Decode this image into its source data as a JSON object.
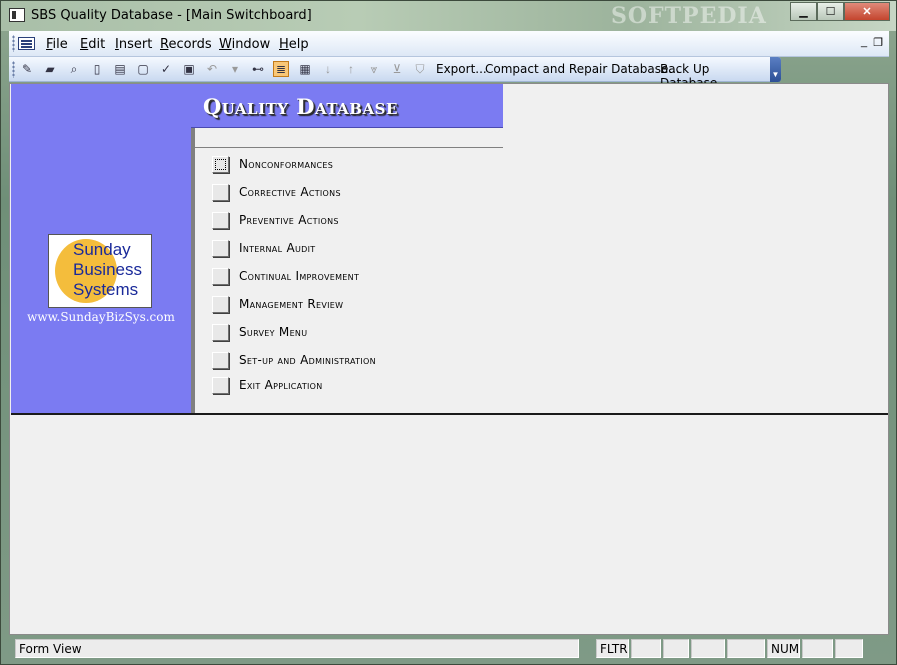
{
  "window": {
    "title": "SBS Quality Database - [Main Switchboard]",
    "watermark": "SOFTPEDIA",
    "controls": {
      "minimize": "▁",
      "maximize": "☐",
      "close": "✕"
    }
  },
  "menubar": {
    "items": [
      "File",
      "Edit",
      "Insert",
      "Records",
      "Window",
      "Help"
    ],
    "mdi_minimize": "_",
    "mdi_restore": "❐"
  },
  "toolbar": {
    "icons": [
      "design-view-icon",
      "open-icon",
      "search-icon",
      "print-preview-book-icon",
      "print-icon",
      "print-preview-icon",
      "spelling-icon",
      "paste-icon",
      "undo-icon",
      "find-icon",
      "form-view-icon",
      "datasheet-icon",
      "sort-icon",
      "filter-selection-icon",
      "filter-form-icon",
      "apply-filter-icon"
    ],
    "export_label": "Export...",
    "compact_label": "Compact and Repair Database...",
    "backup_label": "Back Up Database..."
  },
  "switchboard": {
    "title": "Quality Database",
    "logo": {
      "line1": "Sunday",
      "line2": "Business",
      "line3": "Systems",
      "url": "www.SundayBizSys.com"
    },
    "items": [
      "Nonconformances",
      "Corrective Actions",
      "Preventive Actions",
      "Internal Audit",
      "Continual Improvement",
      "Management Review",
      "Survey Menu",
      "Set-up and Administration",
      "Exit Application"
    ]
  },
  "statusbar": {
    "mode": "Form View",
    "fltr": "FLTR",
    "num": "NUM"
  }
}
